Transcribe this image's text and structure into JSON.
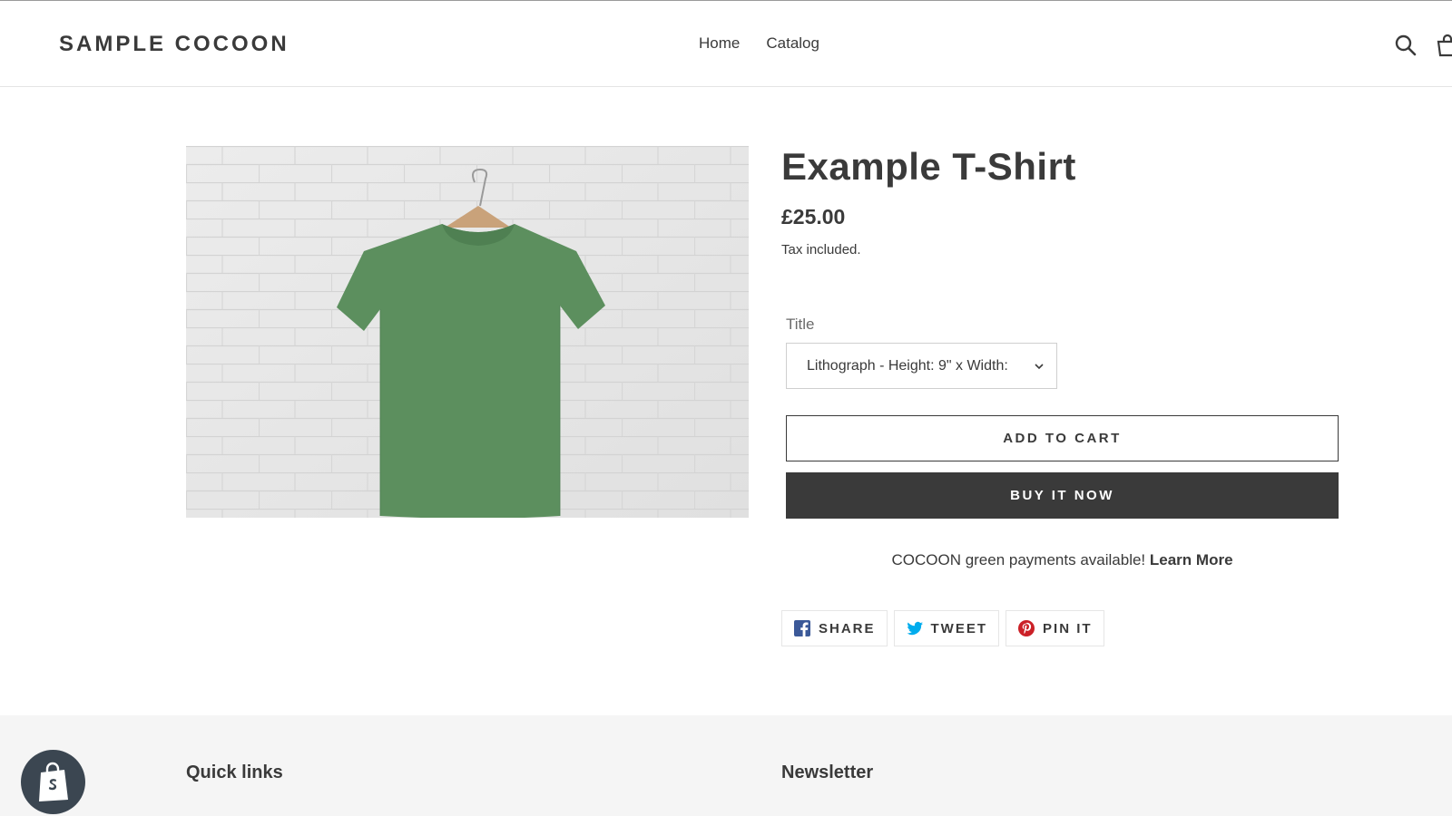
{
  "header": {
    "logo": "SAMPLE COCOON",
    "nav": [
      {
        "label": "Home"
      },
      {
        "label": "Catalog"
      }
    ],
    "icons": [
      "search-icon",
      "cart-icon"
    ]
  },
  "product": {
    "image_alt": "green t-shirt on hanger against white brick wall",
    "title": "Example T-Shirt",
    "price": "£25.00",
    "tax_note": "Tax included.",
    "option_label": "Title",
    "option_selected": "Lithograph - Height: 9\" x Width:",
    "add_to_cart": "ADD TO CART",
    "buy_now": "BUY IT NOW",
    "promo_text": "COCOON green payments available!",
    "promo_link": "Learn More"
  },
  "share": [
    {
      "label": "SHARE",
      "icon": "facebook-icon",
      "color": "#3b5998"
    },
    {
      "label": "TWEET",
      "icon": "twitter-icon",
      "color": "#00aced"
    },
    {
      "label": "PIN IT",
      "icon": "pinterest-icon",
      "color": "#cb2027"
    }
  ],
  "footer": {
    "quick_links": "Quick links",
    "newsletter": "Newsletter"
  },
  "colors": {
    "text": "#3a3a3a",
    "buy_now_bg": "#3a3a3a",
    "footer_bg": "#f5f5f5",
    "shirt": "#5a8f5c"
  }
}
